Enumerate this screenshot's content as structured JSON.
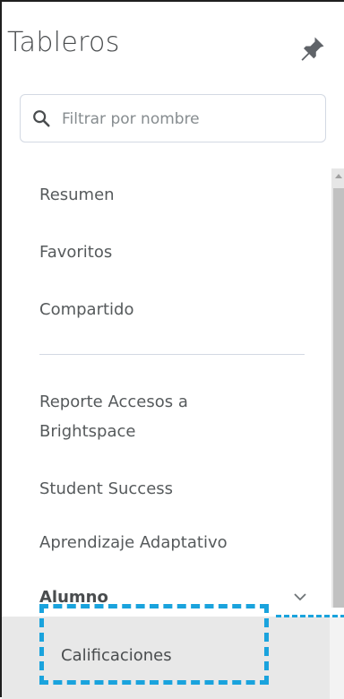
{
  "header": {
    "title": "Tableros",
    "pin_icon": "pin-icon"
  },
  "search": {
    "placeholder": "Filtrar por nombre",
    "icon": "search-icon"
  },
  "nav": {
    "primary": [
      "Resumen",
      "Favoritos",
      "Compartido"
    ],
    "dashboards": [
      "Reporte Accesos a Brightspace",
      "Student Success",
      "Aprendizaje Adaptativo"
    ],
    "group": {
      "label": "Alumno",
      "icon": "chevron-down-icon",
      "children": [
        "Calificaciones"
      ]
    }
  },
  "colors": {
    "highlight": "#1aa3dd",
    "text": "#494c4e",
    "subtle": "#565a5c"
  }
}
